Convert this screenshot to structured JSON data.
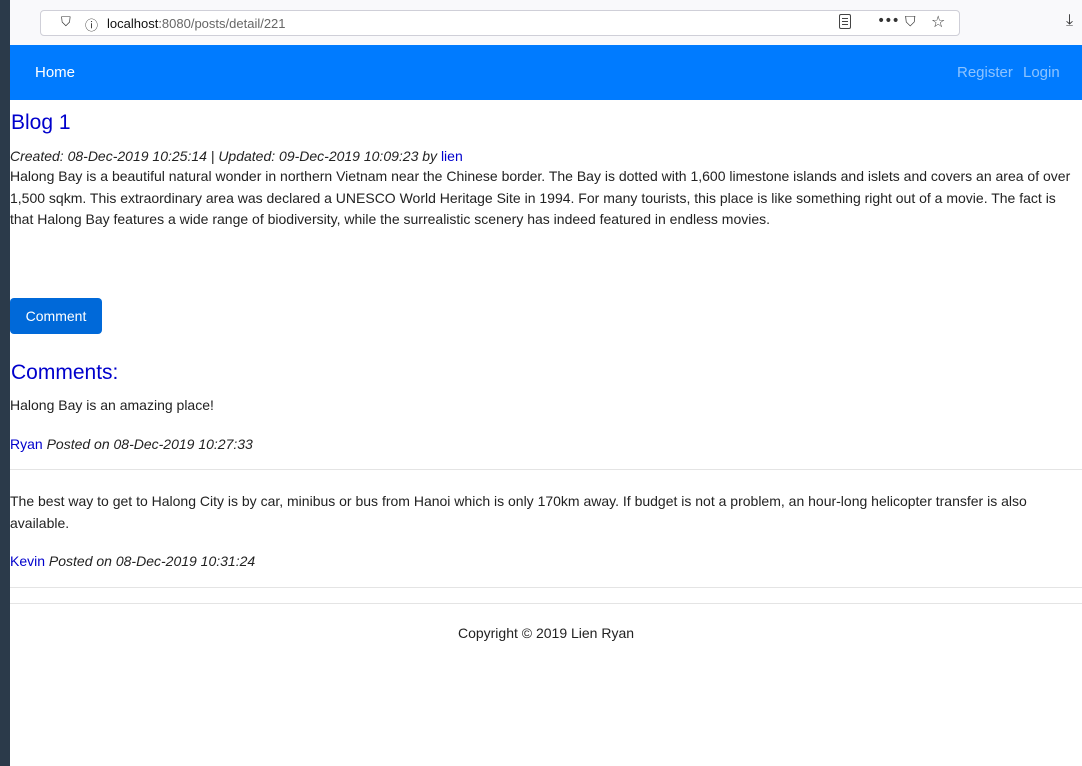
{
  "browser": {
    "url_host": "localhost",
    "url_rest": ":8080/posts/detail/221"
  },
  "navbar": {
    "home": "Home",
    "register": "Register",
    "login": "Login",
    "bg_color": "#007bff"
  },
  "post": {
    "title": "Blog 1",
    "meta_prefix": "Created: 08-Dec-2019 10:25:14 | Updated: 09-Dec-2019 10:09:23 by ",
    "author": "lien",
    "content": "Halong Bay is a beautiful natural wonder in northern Vietnam near the Chinese border. The Bay is dotted with 1,600 limestone islands and islets and covers an area of over 1,500 sqkm. This extraordinary area was declared a UNESCO World Heritage Site in 1994. For many tourists, this place is like something right out of a movie. The fact is that Halong Bay features a wide range of biodiversity, while the surrealistic scenery has indeed featured in endless movies."
  },
  "comment_button": "Comment",
  "comments_heading": "Comments:",
  "comments": [
    {
      "text": "Halong Bay is an amazing place!",
      "author": "Ryan",
      "posted": " Posted on 08-Dec-2019 10:27:33"
    },
    {
      "text": "The best way to get to Halong City is by car, minibus or bus from Hanoi which is only 170km away. If budget is not a problem, an hour-long helicopter transfer is also available.",
      "author": "Kevin",
      "posted": " Posted on 08-Dec-2019 10:31:24"
    }
  ],
  "footer": "Copyright © 2019 Lien Ryan"
}
